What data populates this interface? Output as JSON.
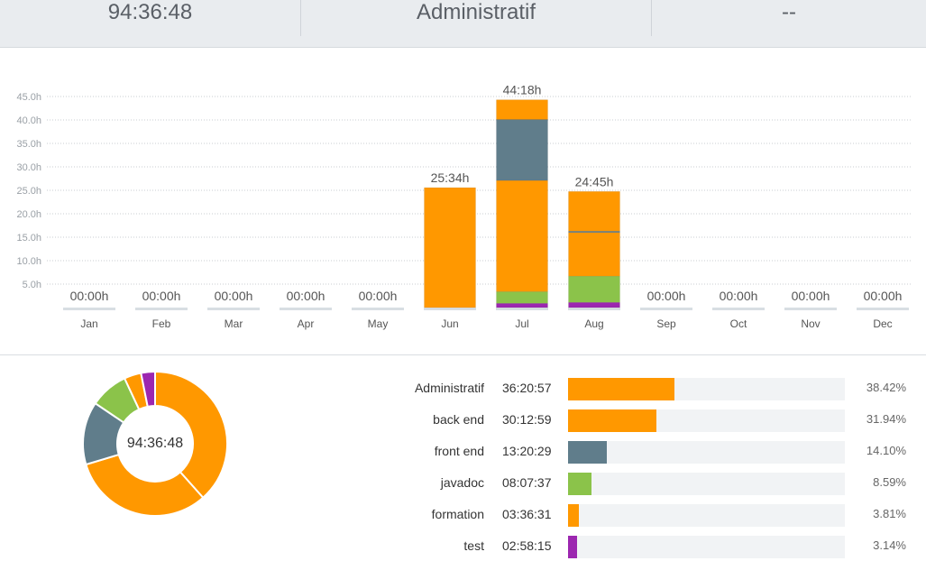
{
  "header": {
    "total_time": "94:36:48",
    "selected_project": "Administratif",
    "third": "--"
  },
  "chart_data": {
    "type": "bar",
    "stacked": true,
    "categories": [
      "Jan",
      "Feb",
      "Mar",
      "Apr",
      "May",
      "Jun",
      "Jul",
      "Aug",
      "Sep",
      "Oct",
      "Nov",
      "Dec"
    ],
    "totals_labels": [
      "00:00h",
      "00:00h",
      "00:00h",
      "00:00h",
      "00:00h",
      "25:34h",
      "44:18h",
      "24:45h",
      "00:00h",
      "00:00h",
      "00:00h",
      "00:00h"
    ],
    "y_ticks": [
      "5.0h",
      "10.0h",
      "15.0h",
      "20.0h",
      "25.0h",
      "30.0h",
      "35.0h",
      "40.0h",
      "45.0h"
    ],
    "ylim": [
      0,
      45
    ],
    "grid": true,
    "series": [
      {
        "name": "test",
        "color": "#9c27b0",
        "values": [
          0,
          0,
          0,
          0,
          0,
          0,
          0.9,
          1.1,
          0,
          0,
          0,
          0
        ]
      },
      {
        "name": "javadoc",
        "color": "#8bc34a",
        "values": [
          0,
          0,
          0,
          0,
          0,
          0,
          2.5,
          5.6,
          0,
          0,
          0,
          0
        ]
      },
      {
        "name": "Administratif",
        "color": "#ff9800",
        "values": [
          0,
          0,
          0,
          0,
          0,
          25.57,
          23.7,
          9.3,
          0,
          0,
          0,
          0
        ]
      },
      {
        "name": "front end",
        "color": "#607d8b",
        "values": [
          0,
          0,
          0,
          0,
          0,
          0,
          13.0,
          0.3,
          0,
          0,
          0,
          0
        ]
      },
      {
        "name": "back end",
        "color": "#ff9800",
        "values": [
          0,
          0,
          0,
          0,
          0,
          0,
          4.2,
          8.45,
          0,
          0,
          0,
          0
        ]
      }
    ]
  },
  "donut": {
    "center_label": "94:36:48",
    "slices": [
      {
        "name": "Administratif",
        "percent": 38.42,
        "color": "#ff9800"
      },
      {
        "name": "back end",
        "percent": 31.94,
        "color": "#ff9800"
      },
      {
        "name": "front end",
        "percent": 14.1,
        "color": "#607d8b"
      },
      {
        "name": "javadoc",
        "percent": 8.59,
        "color": "#8bc34a"
      },
      {
        "name": "formation",
        "percent": 3.81,
        "color": "#ff9800"
      },
      {
        "name": "test",
        "percent": 3.14,
        "color": "#9c27b0"
      }
    ]
  },
  "breakdown": [
    {
      "name": "Administratif",
      "time": "36:20:57",
      "percent": "38.42%",
      "fraction": 0.3842,
      "color": "#ff9800"
    },
    {
      "name": "back end",
      "time": "30:12:59",
      "percent": "31.94%",
      "fraction": 0.3194,
      "color": "#ff9800"
    },
    {
      "name": "front end",
      "time": "13:20:29",
      "percent": "14.10%",
      "fraction": 0.141,
      "color": "#607d8b"
    },
    {
      "name": "javadoc",
      "time": "08:07:37",
      "percent": "8.59%",
      "fraction": 0.0859,
      "color": "#8bc34a"
    },
    {
      "name": "formation",
      "time": "03:36:31",
      "percent": "3.81%",
      "fraction": 0.0381,
      "color": "#ff9800"
    },
    {
      "name": "test",
      "time": "02:58:15",
      "percent": "3.14%",
      "fraction": 0.0314,
      "color": "#9c27b0"
    }
  ]
}
